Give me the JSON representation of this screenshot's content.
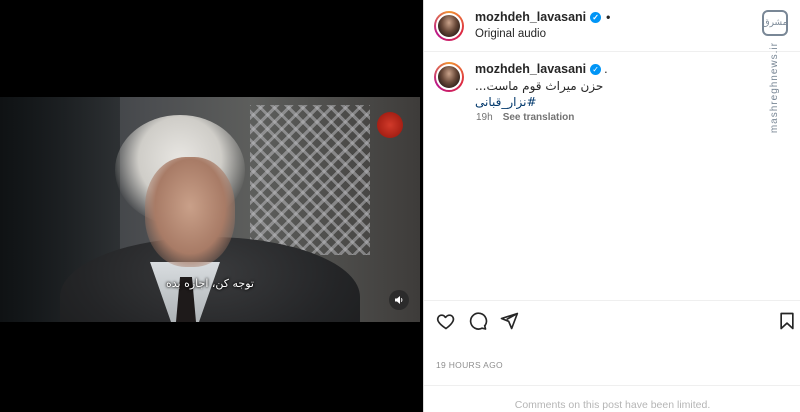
{
  "post": {
    "username": "mozhdeh_lavasani",
    "audio": "Original audio",
    "caption_text": "حزن میراث قوم ماست...",
    "hashtag": "#نزار_قبانی",
    "age": "19h",
    "see_translation": "See translation",
    "timestamp": "19 HOURS AGO",
    "comments_limited": "Comments on this post have been limited."
  },
  "video": {
    "subtitle": "توجه کن، اجازه بده"
  },
  "watermark": {
    "badge": "مشرق",
    "url": "mashreghnews.ir"
  },
  "icons": {
    "verified": "verified-badge-icon",
    "like": "heart-icon",
    "comment": "comment-icon",
    "share": "paper-plane-icon",
    "save": "bookmark-icon",
    "mute": "speaker-icon"
  },
  "colors": {
    "link": "#00376b",
    "verified": "#0095f6",
    "muted_text": "#737373"
  }
}
